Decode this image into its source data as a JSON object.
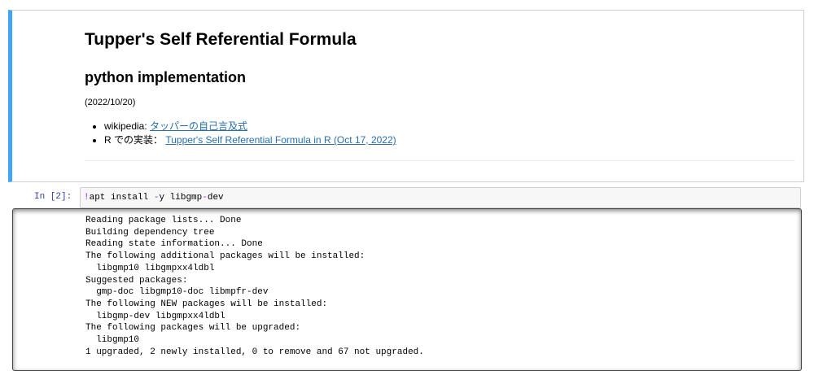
{
  "markdown_cell": {
    "title": "Tupper's Self Referential Formula",
    "subtitle": "python implementation",
    "date": "(2022/10/20)",
    "links": [
      {
        "prefix": "wikipedia: ",
        "link_text": "タッパーの自己言及式"
      },
      {
        "prefix": "R での実装： ",
        "link_text": "Tupper's Self Referential Formula in R (Oct 17, 2022)"
      }
    ]
  },
  "code_cell": {
    "prompt": "In [2]:",
    "code": {
      "bang": "!",
      "part1": "apt install ",
      "op1": "-",
      "part2": "y libgmp",
      "op2": "-",
      "part3": "dev"
    },
    "output_lines": [
      "Reading package lists... Done",
      "Building dependency tree",
      "Reading state information... Done",
      "The following additional packages will be installed:",
      "  libgmp10 libgmpxx4ldbl",
      "Suggested packages:",
      "  gmp-doc libgmp10-doc libmpfr-dev",
      "The following NEW packages will be installed:",
      "  libgmp-dev libgmpxx4ldbl",
      "The following packages will be upgraded:",
      "  libgmp10",
      "1 upgraded, 2 newly installed, 0 to remove and 67 not upgraded."
    ]
  },
  "colors": {
    "selected_cell_border": "#42a5f5",
    "link": "#296eaa",
    "prompt": "#303f9f",
    "code_background": "#f7f7f7"
  }
}
